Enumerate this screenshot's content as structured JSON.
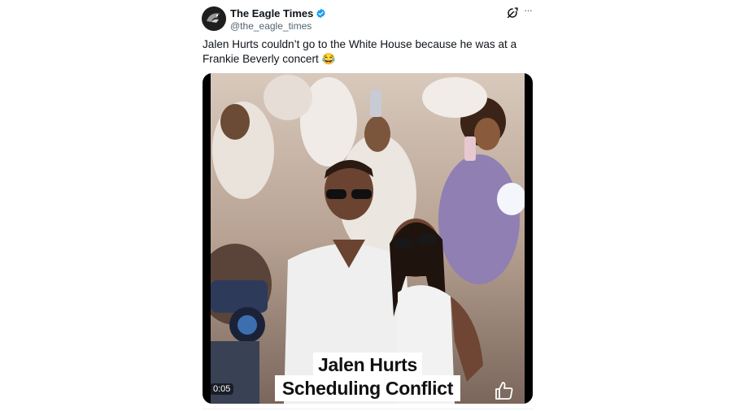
{
  "author": {
    "display_name": "The Eagle Times",
    "handle": "@the_eagle_times",
    "verified": true,
    "verified_color": "#1d9bf0",
    "avatar_icon": "eagle-avatar-icon"
  },
  "header_actions": {
    "grok_icon": "grok-icon",
    "more_icon": "more-options-icon",
    "more_label": "···"
  },
  "tweet": {
    "text": "Jalen Hurts couldn’t go to the White House because he was at a Frankie Beverly concert 😂"
  },
  "media": {
    "type": "video",
    "duration": "0:05",
    "caption_line1": "Jalen Hurts",
    "caption_line2": "Scheduling Conflict",
    "overlay_icon": "thumbs-up-icon"
  }
}
